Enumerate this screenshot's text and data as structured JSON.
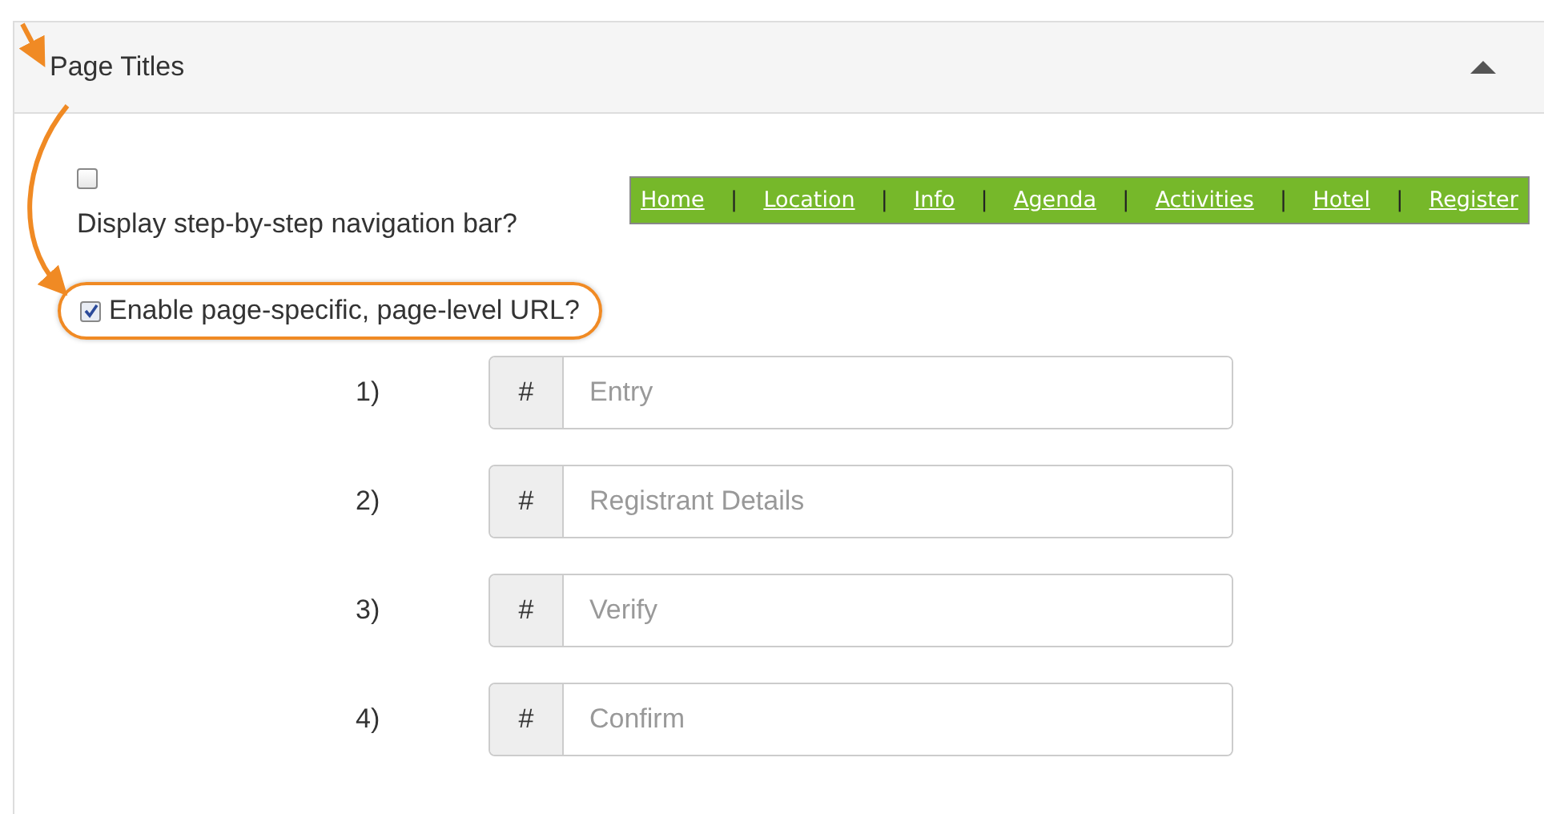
{
  "panel": {
    "title": "Page Titles",
    "expanded": true
  },
  "options": [
    {
      "label": "Display step-by-step navigation bar?",
      "checked": false
    },
    {
      "label": "Enable page-specific, page-level URL?",
      "checked": true
    }
  ],
  "nav_preview": [
    {
      "kind": "link",
      "label": "Home"
    },
    {
      "kind": "separator",
      "label": "|"
    },
    {
      "kind": "link",
      "label": "Location"
    },
    {
      "kind": "separator",
      "label": "|"
    },
    {
      "kind": "link",
      "label": "Info"
    },
    {
      "kind": "separator",
      "label": "|"
    },
    {
      "kind": "link",
      "label": "Agenda"
    },
    {
      "kind": "separator",
      "label": "|"
    },
    {
      "kind": "link",
      "label": "Activities"
    },
    {
      "kind": "separator",
      "label": "|"
    },
    {
      "kind": "link",
      "label": "Hotel"
    },
    {
      "kind": "separator",
      "label": "|"
    },
    {
      "kind": "link",
      "label": "Register"
    }
  ],
  "page_urls": [
    {
      "number": "1)",
      "prefix": "#",
      "placeholder": "Entry"
    },
    {
      "number": "2)",
      "prefix": "#",
      "placeholder": "Registrant Details"
    },
    {
      "number": "3)",
      "prefix": "#",
      "placeholder": "Verify"
    },
    {
      "number": "4)",
      "prefix": "#",
      "placeholder": "Confirm"
    }
  ]
}
